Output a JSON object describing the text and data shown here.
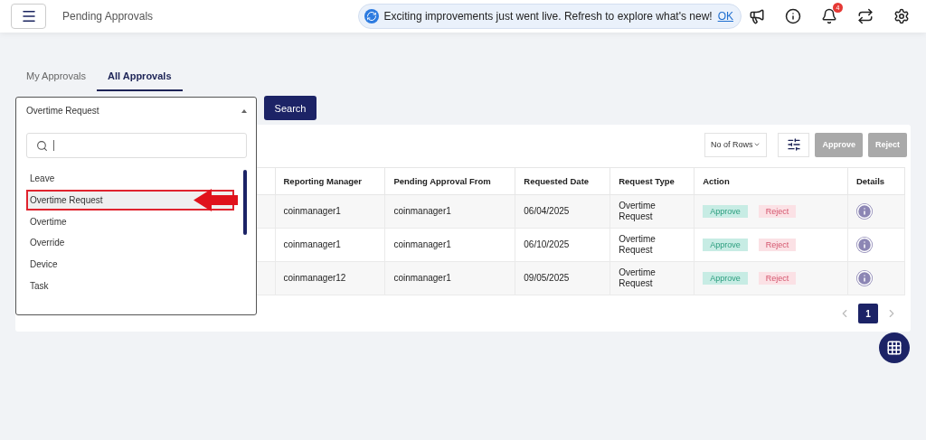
{
  "header": {
    "title": "Pending Approvals",
    "notice": {
      "text": "Exciting improvements just went live. Refresh to explore what's new!",
      "link": "OK"
    },
    "notification_count": "4"
  },
  "tabs": [
    {
      "label": "My Approvals",
      "selected": false
    },
    {
      "label": "All Approvals",
      "selected": true
    }
  ],
  "filter": {
    "value": "Overtime Request",
    "expanded": true,
    "options": [
      {
        "label": "Leave",
        "selected": false,
        "highlighted": false
      },
      {
        "label": "Overtime Request",
        "selected": true,
        "highlighted": true
      },
      {
        "label": "Overtime",
        "selected": false,
        "highlighted": false
      },
      {
        "label": "Override",
        "selected": false,
        "highlighted": false
      },
      {
        "label": "Device",
        "selected": false,
        "highlighted": false
      },
      {
        "label": "Task",
        "selected": false,
        "highlighted": false
      }
    ]
  },
  "search_button": "Search",
  "toolbar": {
    "rows_label": "No of Rows",
    "approve": "Approve",
    "reject": "Reject",
    "bulk_disabled": true
  },
  "table": {
    "columns": [
      "Reporting Manager",
      "Pending Approval From",
      "Requested Date",
      "Request Type",
      "Action",
      "Details"
    ],
    "rows": [
      {
        "reporting_manager": "coinmanager1",
        "pending_from": "coinmanager1",
        "date": "06/04/2025",
        "type": "Overtime Request",
        "approve": "Approve",
        "reject": "Reject"
      },
      {
        "reporting_manager": "coinmanager1",
        "pending_from": "coinmanager1",
        "date": "06/10/2025",
        "type": "Overtime Request",
        "approve": "Approve",
        "reject": "Reject"
      },
      {
        "reporting_manager": "coinmanager12",
        "pending_from": "coinmanager1",
        "date": "09/05/2025",
        "type": "Overtime Request",
        "approve": "Approve",
        "reject": "Reject"
      }
    ]
  },
  "pagination": {
    "pages": [
      {
        "label": "1",
        "selected": true
      }
    ]
  }
}
